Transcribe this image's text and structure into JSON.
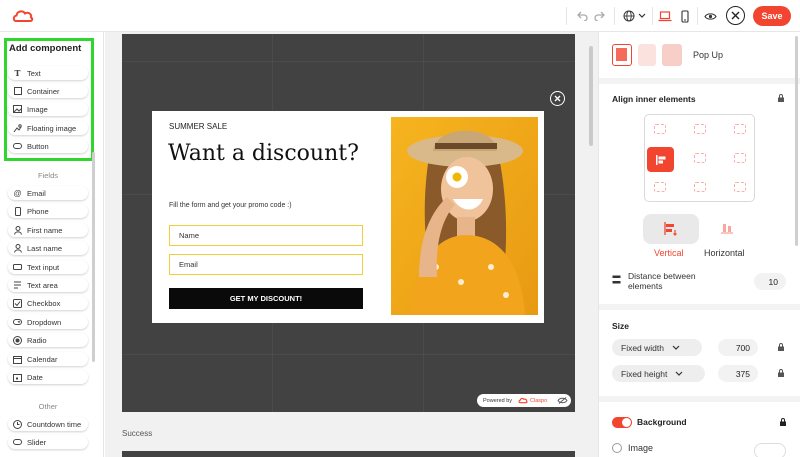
{
  "toolbar": {
    "save_label": "Save",
    "accent_color": "#f2452f"
  },
  "sidebar": {
    "add_component_title": "Add component",
    "components": [
      {
        "label": "Text",
        "icon": "text-icon"
      },
      {
        "label": "Container",
        "icon": "container-icon"
      },
      {
        "label": "Image",
        "icon": "image-icon"
      },
      {
        "label": "Floating image",
        "icon": "floating-image-icon"
      },
      {
        "label": "Button",
        "icon": "button-icon"
      }
    ],
    "fields_title": "Fields",
    "fields": [
      {
        "label": "Email",
        "icon": "at-icon"
      },
      {
        "label": "Phone",
        "icon": "phone-icon"
      },
      {
        "label": "First name",
        "icon": "person-icon"
      },
      {
        "label": "Last name",
        "icon": "person-icon"
      },
      {
        "label": "Text input",
        "icon": "text-input-icon"
      },
      {
        "label": "Text area",
        "icon": "text-area-icon"
      },
      {
        "label": "Checkbox",
        "icon": "checkbox-icon"
      },
      {
        "label": "Dropdown",
        "icon": "dropdown-icon"
      },
      {
        "label": "Radio",
        "icon": "radio-icon"
      },
      {
        "label": "Calendar",
        "icon": "calendar-icon"
      },
      {
        "label": "Date",
        "icon": "date-icon"
      }
    ],
    "other_title": "Other",
    "other": [
      {
        "label": "Countdown time",
        "icon": "countdown-icon"
      },
      {
        "label": "Slider",
        "icon": "slider-icon"
      }
    ]
  },
  "popup": {
    "small_title": "SUMMER SALE",
    "headline": "Want a discount?",
    "description": "Fill the form and get your promo code :)",
    "name_placeholder": "Name",
    "email_placeholder": "Email",
    "cta_label": "GET MY DISCOUNT!",
    "field_border_color": "#f0cf3a"
  },
  "canvas": {
    "powered_by": "Powered by",
    "brand": "Claspo",
    "success_label": "Success"
  },
  "right_panel": {
    "layout_label": "Pop Up",
    "align_title": "Align inner elements",
    "vertical_label": "Vertical",
    "horizontal_label": "Horizontal",
    "distance_label": "Distance between elements",
    "distance_value": "10",
    "size_title": "Size",
    "width_mode": "Fixed width",
    "width_value": "700",
    "height_mode": "Fixed height",
    "height_value": "375",
    "background_title": "Background",
    "background_enabled": true,
    "image_option": "Image"
  }
}
